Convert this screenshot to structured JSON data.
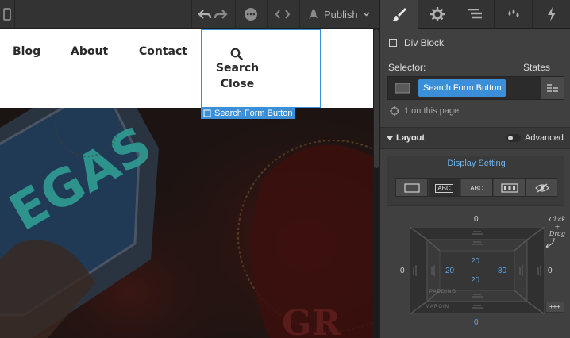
{
  "toolbar": {
    "publish_label": "Publish"
  },
  "canvas": {
    "nav_links": [
      "Blog",
      "About",
      "Contact"
    ],
    "search_label": "Search",
    "close_label": "Close",
    "selected_tag": "Search Form Button"
  },
  "panel": {
    "tabs": [
      "style-tab",
      "settings-tab",
      "navigator-tab",
      "interactions-tab",
      "lightning-tab"
    ],
    "element_type": "Div Block",
    "selector_label": "Selector:",
    "states_label": "States",
    "selector_chip": "Search Form Button",
    "on_page": "1 on this page",
    "layout_title": "Layout",
    "advanced_label": "Advanced",
    "display_setting": "Display Setting",
    "display_options": [
      "block",
      "inline-block",
      "inline",
      "flex",
      "none"
    ],
    "display_texts": {
      "inline_block": "ABC",
      "inline": "ABC"
    },
    "box": {
      "margin_top": "0",
      "margin_left": "0",
      "margin_right": "0",
      "margin_bottom": "0",
      "padding_top": "20",
      "padding_left": "20",
      "padding_right": "80",
      "padding_bottom": "20",
      "padding_label": "PADDING",
      "margin_label": "MARGIN",
      "click_drag_hint": "Click + Drag",
      "more_label": "+++"
    }
  },
  "colors": {
    "accent": "#3b8fd9",
    "panel_bg": "#404040",
    "toolbar_bg": "#333333"
  }
}
